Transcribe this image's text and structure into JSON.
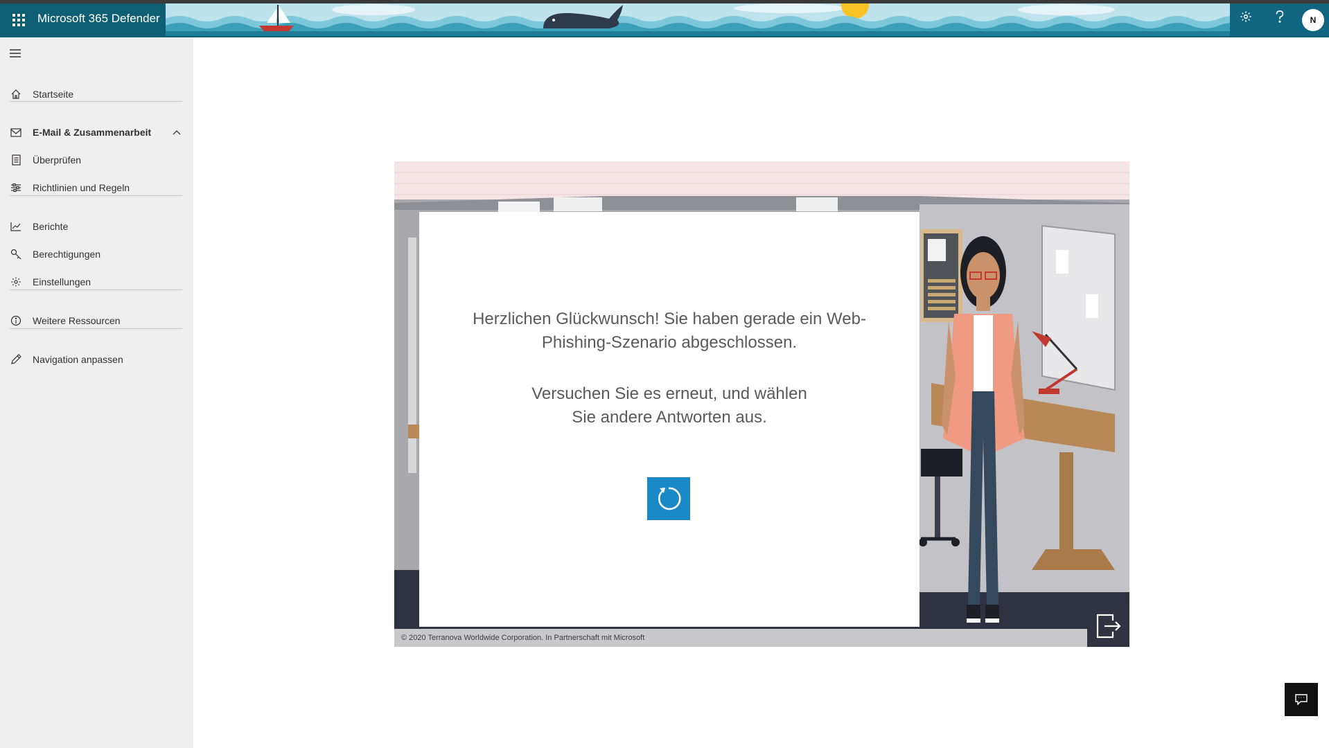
{
  "header": {
    "app_title": "Microsoft 365 Defender",
    "avatar_initials": "N"
  },
  "sidebar": {
    "items": [
      {
        "label": "Startseite",
        "icon": "home-icon"
      },
      {
        "label": "E-Mail & Zusammenarbeit",
        "icon": "mail-icon"
      },
      {
        "label": "Überprüfen",
        "icon": "document-icon"
      },
      {
        "label": "Richtlinien und Regeln",
        "icon": "sliders-icon"
      },
      {
        "label": "Berichte",
        "icon": "chart-line-icon"
      },
      {
        "label": "Berechtigungen",
        "icon": "key-icon"
      },
      {
        "label": "Einstellungen",
        "icon": "gear-icon"
      },
      {
        "label": "Weitere Ressourcen",
        "icon": "info-icon"
      },
      {
        "label": "Navigation anpassen",
        "icon": "pencil-icon"
      }
    ]
  },
  "scene": {
    "message_line": "Herzlichen Glückwunsch! Sie haben gerade ein Web-Phishing-Szenario abgeschlossen.",
    "retry_line": "Versuchen Sie es erneut, und wählen Sie andere Antworten aus.",
    "copyright": "© 2020 Terranova Worldwide Corporation. In Partnerschaft mit Microsoft"
  },
  "colors": {
    "header": "#0f5f73",
    "sidebar": "#efefef",
    "retry_button": "#1a89c6"
  }
}
